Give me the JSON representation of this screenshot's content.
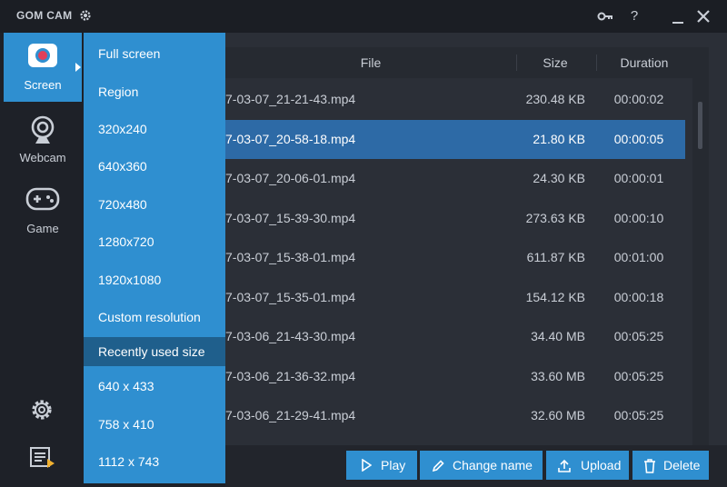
{
  "window": {
    "title": "GOM CAM",
    "help_label": "?"
  },
  "sidebar": {
    "items": [
      {
        "label": "Screen",
        "icon": "record-icon",
        "active": true
      },
      {
        "label": "Webcam",
        "icon": "webcam-icon",
        "active": false
      },
      {
        "label": "Game",
        "icon": "gamepad-icon",
        "active": false
      }
    ],
    "bottom_icons": [
      "gear-icon",
      "playlist-icon"
    ]
  },
  "menu": {
    "items": [
      "Full screen",
      "Region",
      "320x240",
      "640x360",
      "720x480",
      "1280x720",
      "1920x1080",
      "Custom resolution"
    ],
    "recent_header": "Recently used size",
    "recent_items": [
      "640 x 433",
      "758 x 410",
      "1112 x 743"
    ]
  },
  "table": {
    "headers": {
      "file": "File",
      "size": "Size",
      "duration": "Duration"
    },
    "rows": [
      {
        "file": "7-03-07_21-21-43.mp4",
        "size": "230.48 KB",
        "duration": "00:00:02",
        "selected": false
      },
      {
        "file": "7-03-07_20-58-18.mp4",
        "size": "21.80 KB",
        "duration": "00:00:05",
        "selected": true
      },
      {
        "file": "7-03-07_20-06-01.mp4",
        "size": "24.30 KB",
        "duration": "00:00:01",
        "selected": false
      },
      {
        "file": "7-03-07_15-39-30.mp4",
        "size": "273.63 KB",
        "duration": "00:00:10",
        "selected": false
      },
      {
        "file": "7-03-07_15-38-01.mp4",
        "size": "611.87 KB",
        "duration": "00:01:00",
        "selected": false
      },
      {
        "file": "7-03-07_15-35-01.mp4",
        "size": "154.12 KB",
        "duration": "00:00:18",
        "selected": false
      },
      {
        "file": "7-03-06_21-43-30.mp4",
        "size": "34.40 MB",
        "duration": "00:05:25",
        "selected": false
      },
      {
        "file": "7-03-06_21-36-32.mp4",
        "size": "33.60 MB",
        "duration": "00:05:25",
        "selected": false
      },
      {
        "file": "7-03-06_21-29-41.mp4",
        "size": "32.60 MB",
        "duration": "00:05:25",
        "selected": false
      }
    ]
  },
  "toolbar": {
    "play": "Play",
    "change_name": "Change name",
    "upload": "Upload",
    "delete": "Delete"
  },
  "colors": {
    "accent": "#2f8fd0",
    "selected_row": "#2d6aa6",
    "menu_section": "#1f5f8c",
    "background": "#2b2f37"
  }
}
